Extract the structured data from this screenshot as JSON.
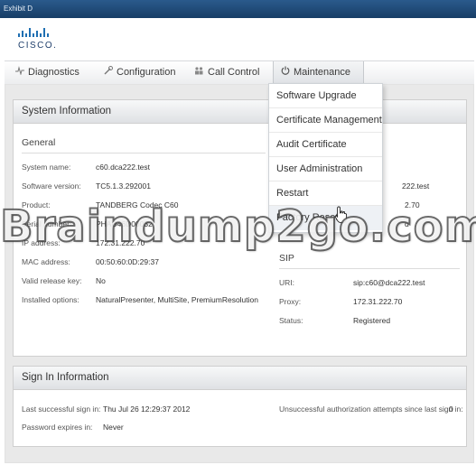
{
  "window": {
    "title": "Exhibit D"
  },
  "brand": {
    "wordmark": "CISCO."
  },
  "nav": {
    "tabs": [
      {
        "label": "Diagnostics",
        "icon": "pulse-icon"
      },
      {
        "label": "Configuration",
        "icon": "wrench-icon"
      },
      {
        "label": "Call Control",
        "icon": "people-icon"
      },
      {
        "label": "Maintenance",
        "icon": "power-icon"
      }
    ]
  },
  "maintenance_menu": {
    "items": [
      "Software Upgrade",
      "Certificate Management",
      "Audit Certificate",
      "User Administration",
      "Restart",
      "Factory Reset"
    ]
  },
  "system_info": {
    "title": "System Information",
    "general": {
      "heading": "General",
      "rows": [
        {
          "label": "System name:",
          "value": "c60.dca222.test"
        },
        {
          "label": "Software version:",
          "value": "TC5.1.3.292001"
        },
        {
          "label": "Product:",
          "value": "TANDBERG Codec C60"
        },
        {
          "label": "Serial number:",
          "value": "PHAD46D00032"
        },
        {
          "label": "IP address:",
          "value": "172.31.222.70"
        },
        {
          "label": "MAC address:",
          "value": "00:50:60:0D:29:37"
        },
        {
          "label": "Valid release key:",
          "value": "No"
        },
        {
          "label": "Installed options:",
          "value": "NaturalPresenter, MultiSite, PremiumResolution"
        }
      ]
    },
    "right_partial": {
      "name": "222.test",
      "ip": "2.70",
      "registered_suffix": "d"
    },
    "sip": {
      "heading": "SIP",
      "rows": [
        {
          "label": "URI:",
          "value": "sip:c60@dca222.test"
        },
        {
          "label": "Proxy:",
          "value": "172.31.222.70"
        },
        {
          "label": "Status:",
          "value": "Registered"
        }
      ]
    }
  },
  "signin": {
    "title": "Sign In Information",
    "last_label": "Last successful sign in:",
    "last_value": "Thu Jul 26 12:29:37 2012",
    "expires_label": "Password expires in:",
    "expires_value": "Never",
    "unsuccessful_label": "Unsuccessful authorization attempts since last sign in:",
    "unsuccessful_value": "0"
  },
  "watermark": "Braindump2go.com"
}
